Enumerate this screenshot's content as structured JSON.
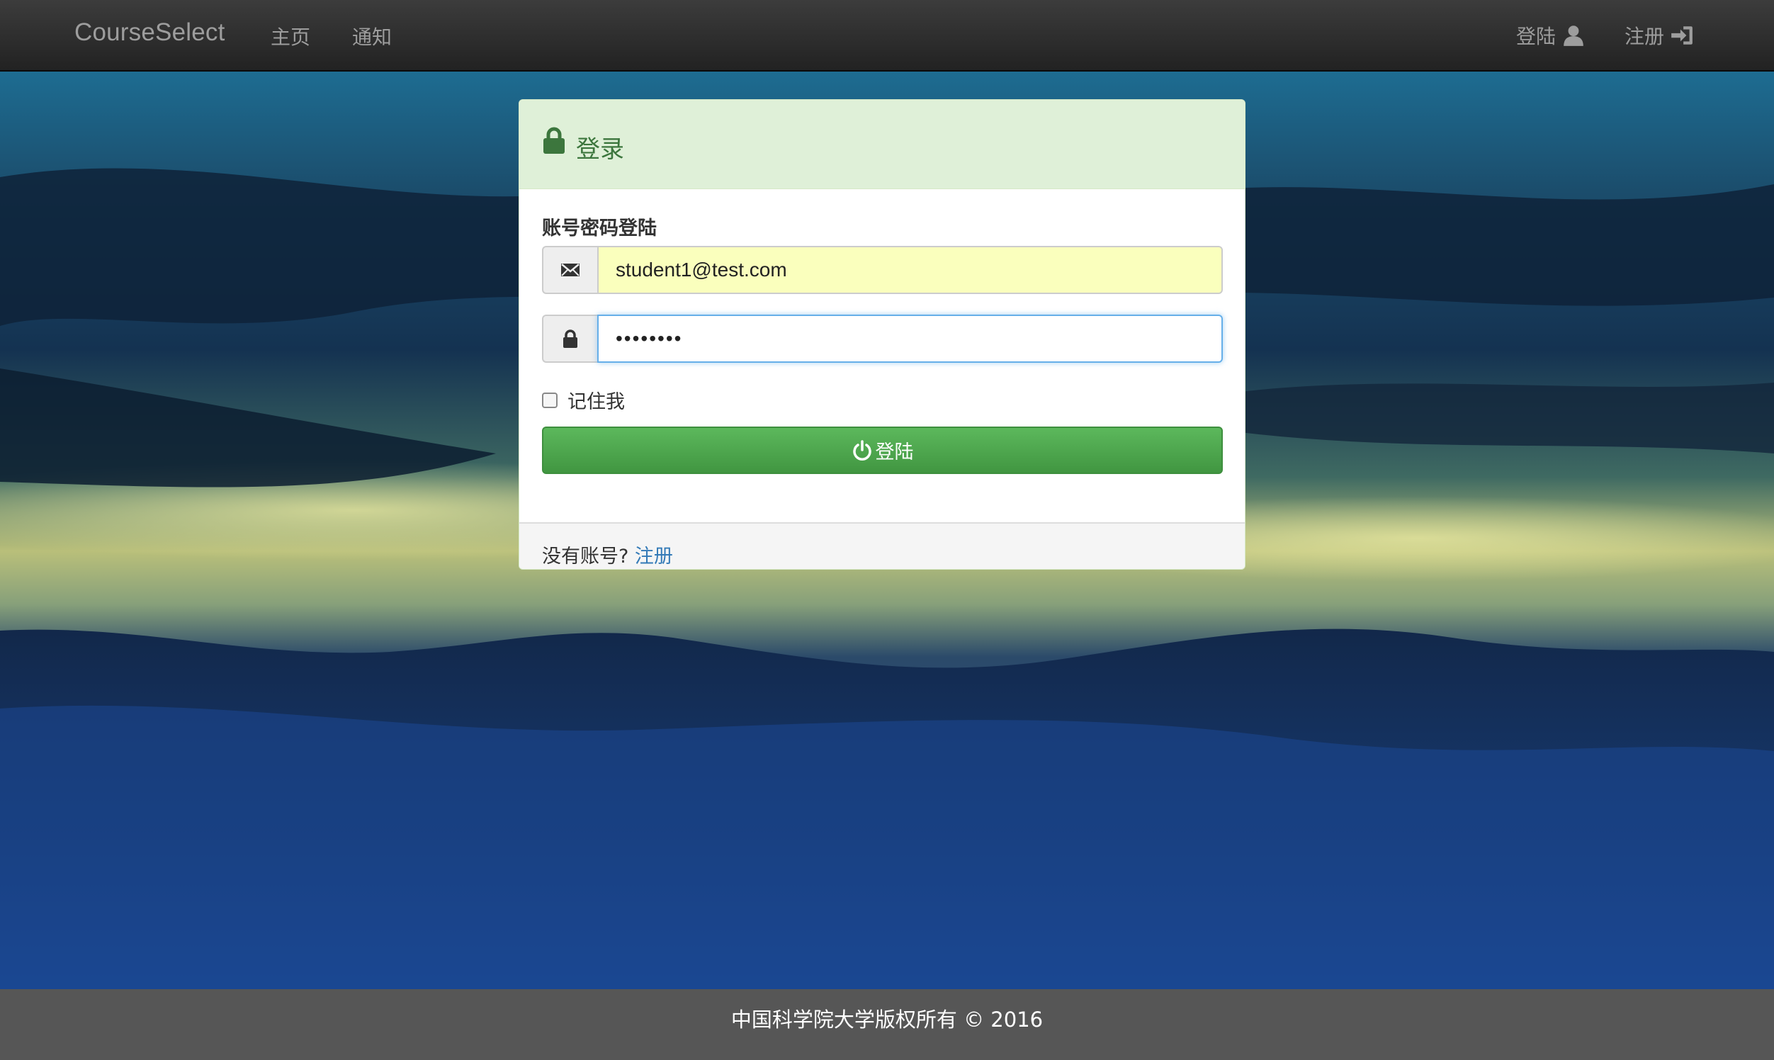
{
  "navbar": {
    "brand": "CourseSelect",
    "links": [
      {
        "label": "主页"
      },
      {
        "label": "通知"
      }
    ],
    "right": {
      "login_label": "登陆",
      "login_icon": "user-icon",
      "register_label": "注册",
      "register_icon": "log-in-icon"
    }
  },
  "login_panel": {
    "title": "登录",
    "title_icon": "lock-icon",
    "section_label": "账号密码登陆",
    "email": {
      "icon": "envelope-icon",
      "value": "student1@test.com"
    },
    "password": {
      "icon": "lock-icon",
      "masked_value": "••••••••"
    },
    "remember_label": "记住我",
    "remember_checked": false,
    "submit": {
      "icon": "power-icon",
      "label": "登陆"
    },
    "footer": {
      "prompt": "没有账号? ",
      "link_label": "注册"
    }
  },
  "footer": {
    "copyright": "中国科学院大学版权所有 © 2016"
  },
  "colors": {
    "navbar": "#222222",
    "panel_header": "#dff0d8",
    "panel_title": "#3c763d",
    "button": "#5cb85c",
    "link": "#337ab7",
    "autofill": "#faffbd",
    "footer": "#565656"
  }
}
